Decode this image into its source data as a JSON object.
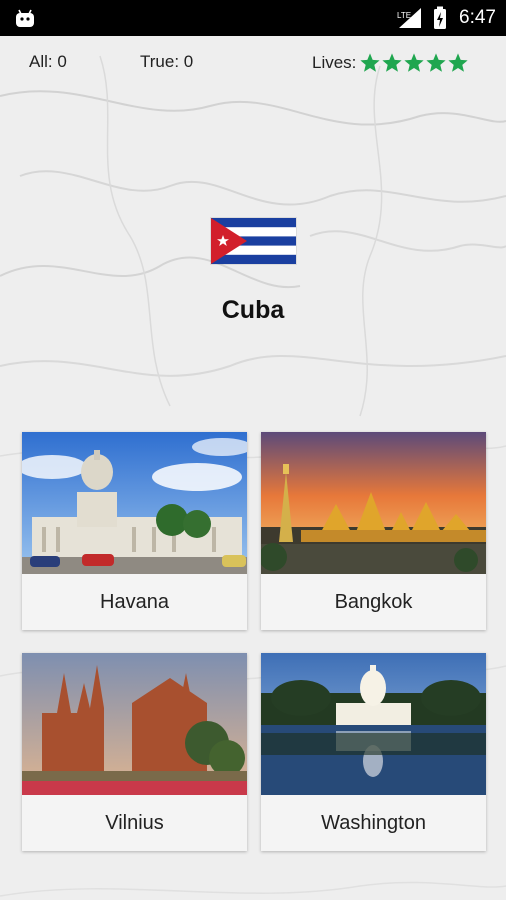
{
  "status_bar": {
    "time": "6:47",
    "network": "LTE"
  },
  "stats": {
    "all": "All: 0",
    "true": "True: 0",
    "lives_label": "Lives:",
    "lives": 5,
    "star_color": "#1fa64f"
  },
  "question": {
    "country": "Cuba",
    "flag_icon": "cuba-flag"
  },
  "options": [
    {
      "label": "Havana"
    },
    {
      "label": "Bangkok"
    },
    {
      "label": "Vilnius"
    },
    {
      "label": "Washington"
    }
  ]
}
